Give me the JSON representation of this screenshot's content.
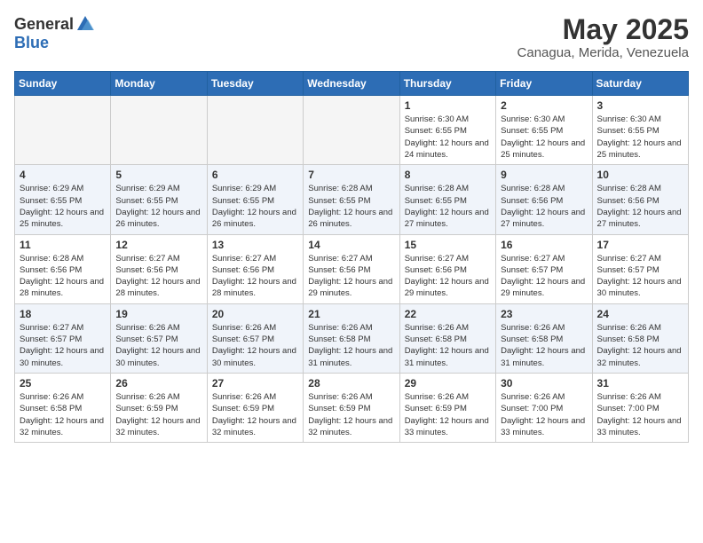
{
  "logo": {
    "general": "General",
    "blue": "Blue"
  },
  "title": "May 2025",
  "location": "Canagua, Merida, Venezuela",
  "weekdays": [
    "Sunday",
    "Monday",
    "Tuesday",
    "Wednesday",
    "Thursday",
    "Friday",
    "Saturday"
  ],
  "weeks": [
    [
      {
        "day": "",
        "info": ""
      },
      {
        "day": "",
        "info": ""
      },
      {
        "day": "",
        "info": ""
      },
      {
        "day": "",
        "info": ""
      },
      {
        "day": "1",
        "info": "Sunrise: 6:30 AM\nSunset: 6:55 PM\nDaylight: 12 hours and 24 minutes."
      },
      {
        "day": "2",
        "info": "Sunrise: 6:30 AM\nSunset: 6:55 PM\nDaylight: 12 hours and 25 minutes."
      },
      {
        "day": "3",
        "info": "Sunrise: 6:30 AM\nSunset: 6:55 PM\nDaylight: 12 hours and 25 minutes."
      }
    ],
    [
      {
        "day": "4",
        "info": "Sunrise: 6:29 AM\nSunset: 6:55 PM\nDaylight: 12 hours and 25 minutes."
      },
      {
        "day": "5",
        "info": "Sunrise: 6:29 AM\nSunset: 6:55 PM\nDaylight: 12 hours and 26 minutes."
      },
      {
        "day": "6",
        "info": "Sunrise: 6:29 AM\nSunset: 6:55 PM\nDaylight: 12 hours and 26 minutes."
      },
      {
        "day": "7",
        "info": "Sunrise: 6:28 AM\nSunset: 6:55 PM\nDaylight: 12 hours and 26 minutes."
      },
      {
        "day": "8",
        "info": "Sunrise: 6:28 AM\nSunset: 6:55 PM\nDaylight: 12 hours and 27 minutes."
      },
      {
        "day": "9",
        "info": "Sunrise: 6:28 AM\nSunset: 6:56 PM\nDaylight: 12 hours and 27 minutes."
      },
      {
        "day": "10",
        "info": "Sunrise: 6:28 AM\nSunset: 6:56 PM\nDaylight: 12 hours and 27 minutes."
      }
    ],
    [
      {
        "day": "11",
        "info": "Sunrise: 6:28 AM\nSunset: 6:56 PM\nDaylight: 12 hours and 28 minutes."
      },
      {
        "day": "12",
        "info": "Sunrise: 6:27 AM\nSunset: 6:56 PM\nDaylight: 12 hours and 28 minutes."
      },
      {
        "day": "13",
        "info": "Sunrise: 6:27 AM\nSunset: 6:56 PM\nDaylight: 12 hours and 28 minutes."
      },
      {
        "day": "14",
        "info": "Sunrise: 6:27 AM\nSunset: 6:56 PM\nDaylight: 12 hours and 29 minutes."
      },
      {
        "day": "15",
        "info": "Sunrise: 6:27 AM\nSunset: 6:56 PM\nDaylight: 12 hours and 29 minutes."
      },
      {
        "day": "16",
        "info": "Sunrise: 6:27 AM\nSunset: 6:57 PM\nDaylight: 12 hours and 29 minutes."
      },
      {
        "day": "17",
        "info": "Sunrise: 6:27 AM\nSunset: 6:57 PM\nDaylight: 12 hours and 30 minutes."
      }
    ],
    [
      {
        "day": "18",
        "info": "Sunrise: 6:27 AM\nSunset: 6:57 PM\nDaylight: 12 hours and 30 minutes."
      },
      {
        "day": "19",
        "info": "Sunrise: 6:26 AM\nSunset: 6:57 PM\nDaylight: 12 hours and 30 minutes."
      },
      {
        "day": "20",
        "info": "Sunrise: 6:26 AM\nSunset: 6:57 PM\nDaylight: 12 hours and 30 minutes."
      },
      {
        "day": "21",
        "info": "Sunrise: 6:26 AM\nSunset: 6:58 PM\nDaylight: 12 hours and 31 minutes."
      },
      {
        "day": "22",
        "info": "Sunrise: 6:26 AM\nSunset: 6:58 PM\nDaylight: 12 hours and 31 minutes."
      },
      {
        "day": "23",
        "info": "Sunrise: 6:26 AM\nSunset: 6:58 PM\nDaylight: 12 hours and 31 minutes."
      },
      {
        "day": "24",
        "info": "Sunrise: 6:26 AM\nSunset: 6:58 PM\nDaylight: 12 hours and 32 minutes."
      }
    ],
    [
      {
        "day": "25",
        "info": "Sunrise: 6:26 AM\nSunset: 6:58 PM\nDaylight: 12 hours and 32 minutes."
      },
      {
        "day": "26",
        "info": "Sunrise: 6:26 AM\nSunset: 6:59 PM\nDaylight: 12 hours and 32 minutes."
      },
      {
        "day": "27",
        "info": "Sunrise: 6:26 AM\nSunset: 6:59 PM\nDaylight: 12 hours and 32 minutes."
      },
      {
        "day": "28",
        "info": "Sunrise: 6:26 AM\nSunset: 6:59 PM\nDaylight: 12 hours and 32 minutes."
      },
      {
        "day": "29",
        "info": "Sunrise: 6:26 AM\nSunset: 6:59 PM\nDaylight: 12 hours and 33 minutes."
      },
      {
        "day": "30",
        "info": "Sunrise: 6:26 AM\nSunset: 7:00 PM\nDaylight: 12 hours and 33 minutes."
      },
      {
        "day": "31",
        "info": "Sunrise: 6:26 AM\nSunset: 7:00 PM\nDaylight: 12 hours and 33 minutes."
      }
    ]
  ]
}
